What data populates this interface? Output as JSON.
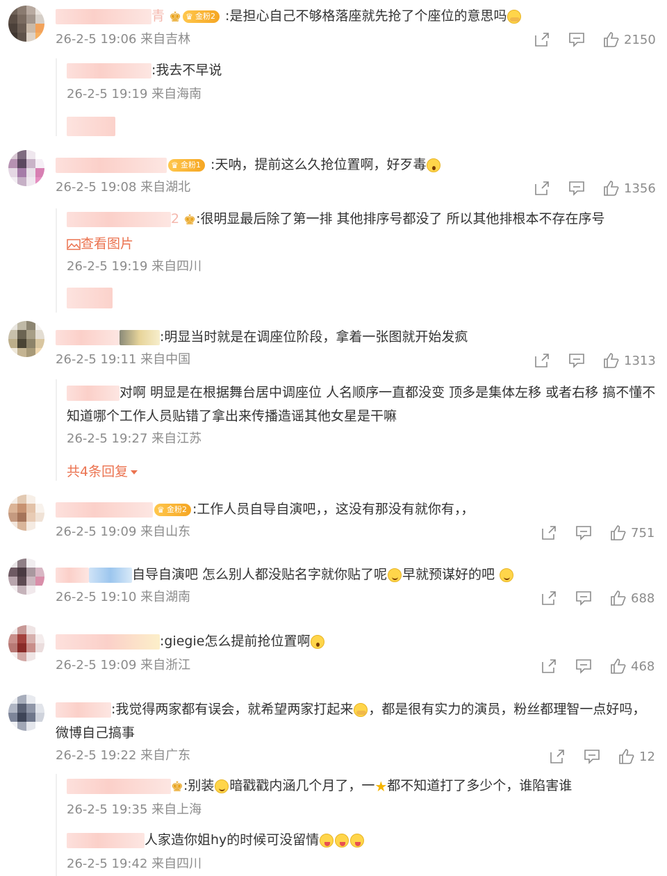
{
  "comments": [
    {
      "text": "是担心自己不够格落座就先抢了个座位的意思吗",
      "badge": "金粉2",
      "name_tail": "青",
      "meta": "26-2-5 19:06 来自吉林",
      "likes": "2150",
      "replies": [
        {
          "text": ":我去不早说",
          "meta": "26-2-5 19:19 来自海南"
        }
      ]
    },
    {
      "text": "天呐，提前这么久抢位置啊，好歹毒",
      "badge": "金粉1",
      "meta": "26-2-5 19:08 来自湖北",
      "likes": "1356",
      "replies": [
        {
          "text": ":很明显最后除了第一排 其他排序号都没了 所以其他排根本不存在序号",
          "name_tail": "2",
          "view_image": "查看图片",
          "meta": "26-2-5 19:19 来自四川"
        }
      ]
    },
    {
      "text": ":明显当时就是在调座位阶段，拿着一张图就开始发疯",
      "meta": "26-2-5 19:11 来自中国",
      "likes": "1313",
      "replies": [
        {
          "text": "对啊 明显是在根据舞台居中调座位 人名顺序一直都没变  顶多是集体左移 或者右移 搞不懂不知道哪个工作人员贴错了拿出来传播造谣其他女星是干嘛",
          "meta": "26-2-5 19:27 来自江苏"
        }
      ],
      "more_replies": "共4条回复"
    },
    {
      "text": ":工作人员自导自演吧，，这没有那没有就你有，，",
      "badge": "金粉2",
      "meta": "26-2-5 19:09 来自山东",
      "likes": "751"
    },
    {
      "text_a": "自导自演吧 怎么别人都没贴名字就你贴了呢",
      "text_b": "早就预谋好的吧",
      "meta": "26-2-5 19:10 来自湖南",
      "likes": "688"
    },
    {
      "text": ":giegie怎么提前抢位置啊",
      "meta": "26-2-5 19:09 来自浙江",
      "likes": "468"
    },
    {
      "text_a": ":我觉得两家都有误会，就希望两家打起来",
      "text_b": "，都是很有实力的演员，粉丝都理智一点好吗，微博自己搞事",
      "meta": "26-2-5 19:22 来自广东",
      "likes": "12",
      "replies": [
        {
          "text_a": ":别装",
          "text_b": "暗戳戳内涵几个月了，一",
          "text_c": "都不知道打了多少个，谁陷害谁",
          "meta": "26-2-5 19:35 来自上海"
        },
        {
          "text": "人家造你姐hy的时候可没留情",
          "meta": "26-2-5 19:42 来自四川"
        }
      ]
    }
  ],
  "colors": {
    "text": "#333333",
    "meta": "#8c8c8c",
    "accent": "#eb7350",
    "badge": "#f5a623",
    "divider": "#f0f0f0"
  },
  "icons": [
    "share-icon",
    "comment-icon",
    "like-icon",
    "image-icon",
    "caret-down-icon",
    "crown-icon"
  ]
}
